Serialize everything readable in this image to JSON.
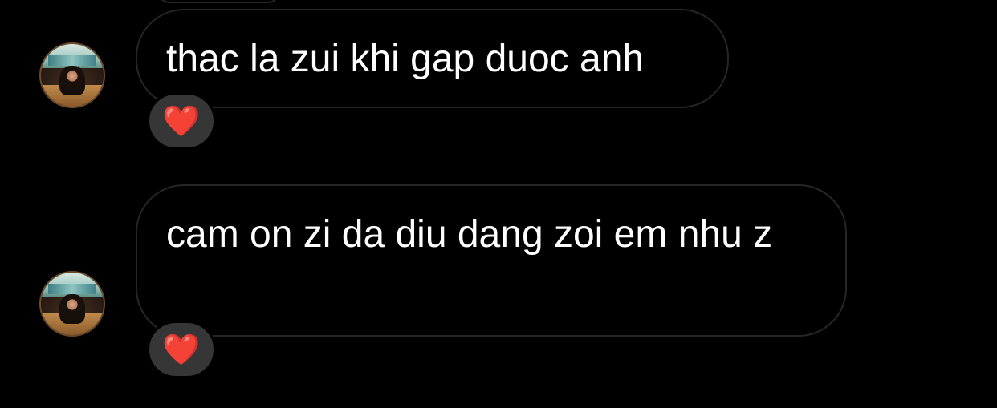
{
  "messages": [
    {
      "text": "thac la zui khi gap duoc anh",
      "reaction": "❤️",
      "reaction_icon": "heart-icon"
    },
    {
      "text": "cam on zi da diu dang zoi em nhu z",
      "reaction": "❤️",
      "reaction_icon": "heart-icon"
    }
  ],
  "colors": {
    "background": "#000000",
    "bubble_border": "#262626",
    "reaction_pill": "#363636",
    "heart": "#e8293c",
    "text": "#ffffff"
  }
}
